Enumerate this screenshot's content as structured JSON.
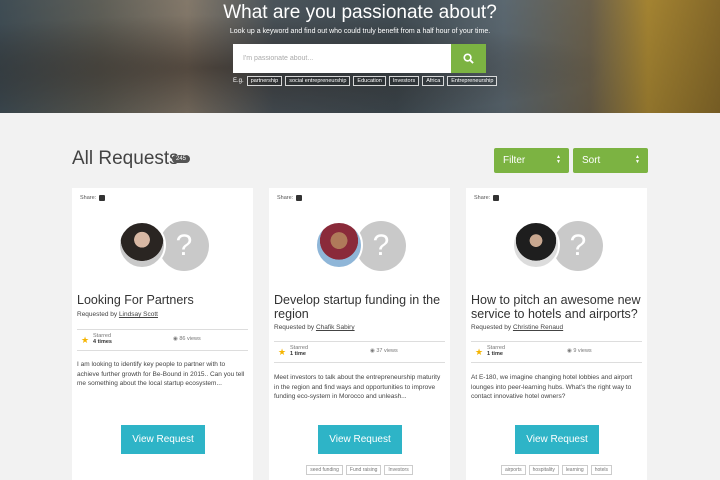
{
  "hero": {
    "title": "What are you passionate about?",
    "subtitle": "Look up a keyword and find out who could truly benefit from a half hour of your time.",
    "search_placeholder": "I'm passionate about...",
    "eg_label": "E.g.",
    "tags": [
      "partnership",
      "social entrepreneurship",
      "Education",
      "Investors",
      "Africa",
      "Entrepreneurship"
    ]
  },
  "requests": {
    "title": "All Requests",
    "count": "245",
    "filter_label": "Filter",
    "sort_label": "Sort"
  },
  "cards": [
    {
      "share_label": "Share:",
      "title": "Looking For Partners",
      "requested_by_label": "Requested by",
      "requester": "Lindsay Scott",
      "starred_label": "Starred",
      "starred_count": "4 times",
      "views": "86 views",
      "description": "I am looking to identify key people to partner with to achieve further growth for Be-Bound in 2015.. Can you tell me something about the local startup ecosystem...",
      "button": "View Request",
      "tags": []
    },
    {
      "share_label": "Share:",
      "title": "Develop startup funding in the region",
      "requested_by_label": "Requested by",
      "requester": "Chafik Sabiry",
      "starred_label": "Starred",
      "starred_count": "1 time",
      "views": "37 views",
      "description": "Meet investors to talk about the entrepreneurship maturity in the region and find ways and opportunities to improve funding eco-system in Morocco and unleash...",
      "button": "View Request",
      "tags": [
        "seed funding",
        "Fund raising",
        "Investors"
      ]
    },
    {
      "share_label": "Share:",
      "title": "How to pitch an awesome new service to hotels and airports?",
      "requested_by_label": "Requested by",
      "requester": "Christine Renaud",
      "starred_label": "Starred",
      "starred_count": "1 time",
      "views": "9 views",
      "description": "At E-180, we imagine changing hotel lobbies and airport lounges into peer-learning hubs. What's the right way to contact innovative hotel owners?",
      "button": "View Request",
      "tags": [
        "airports",
        "hospitality",
        "learning",
        "hotels"
      ]
    }
  ],
  "colors": {
    "accent_green": "#7cb342",
    "button_teal": "#2eb4c7",
    "star": "#f5b400"
  },
  "icons": {
    "search": "search-icon",
    "twitter": "twitter-icon",
    "star": "star-icon",
    "eye": "eye-icon",
    "question": "question-avatar-icon"
  }
}
